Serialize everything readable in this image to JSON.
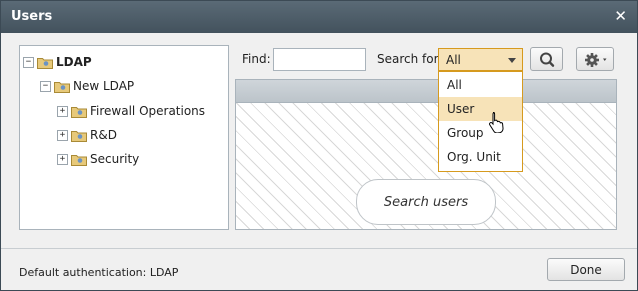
{
  "window": {
    "title": "Users"
  },
  "tree": {
    "nodes": [
      {
        "label": "LDAP",
        "expander": "−"
      },
      {
        "label": "New LDAP",
        "expander": "−"
      },
      {
        "label": "Firewall Operations",
        "expander": "+"
      },
      {
        "label": "R&D",
        "expander": "+"
      },
      {
        "label": "Security",
        "expander": "+"
      }
    ]
  },
  "search": {
    "find_label": "Find:",
    "find_value": "",
    "search_for_label": "Search for:",
    "search_for_value": "All",
    "options": [
      "All",
      "User",
      "Group",
      "Org. Unit"
    ],
    "hovered_option": "User"
  },
  "results": {
    "placeholder": "Search users"
  },
  "footer": {
    "status": "Default authentication: LDAP",
    "done_label": "Done"
  },
  "colors": {
    "titlebar": "#4a5a66",
    "accent": "#d69a1e",
    "highlight": "#f7e3b8"
  }
}
